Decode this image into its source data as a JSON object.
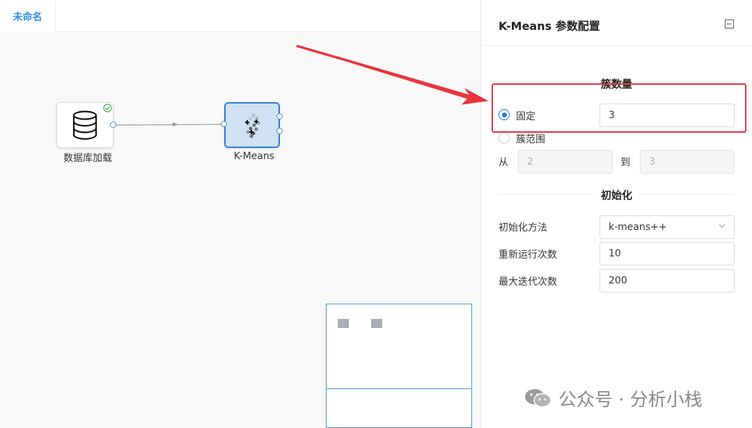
{
  "tabs": [
    {
      "label": "未命名",
      "active": true
    }
  ],
  "nodes": {
    "db": {
      "label": "数据库加载",
      "icon": "database-icon",
      "status": "success-check-icon"
    },
    "kmeans": {
      "label": "K-Means",
      "icon": "kmeans-cluster-icon",
      "selected": true
    }
  },
  "panel": {
    "title": "K-Means 参数配置",
    "collapse_icon": "collapse-icon",
    "cluster_section": {
      "title": "簇数量",
      "fixed": {
        "label": "固定",
        "value": "3",
        "checked": true
      },
      "range": {
        "label": "簇范围",
        "checked": false,
        "from_label": "从",
        "from_value": "2",
        "to_label": "到",
        "to_value": "3"
      }
    },
    "init_section": {
      "title": "初始化",
      "method": {
        "label": "初始化方法",
        "value": "k-means++"
      },
      "n_init": {
        "label": "重新运行次数",
        "value": "10"
      },
      "max_iter": {
        "label": "最大迭代次数",
        "value": "200"
      }
    }
  },
  "watermark": {
    "text": "公众号 · 分析小栈"
  },
  "colors": {
    "accent": "#1f7ae0",
    "annotation": "#e0323a",
    "selected_node_bg": "#cfe1f3"
  }
}
